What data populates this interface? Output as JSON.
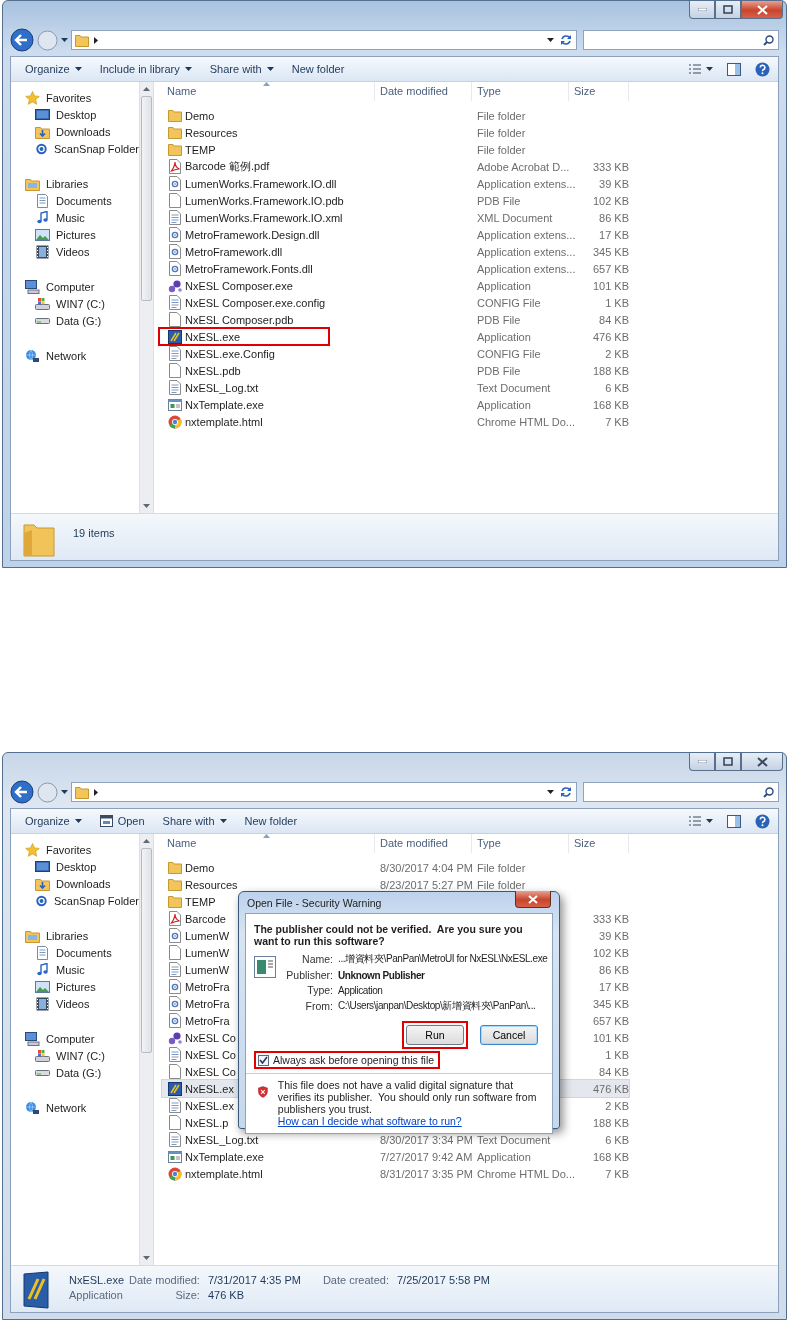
{
  "windows": [
    {
      "active": true,
      "toolbar": [
        {
          "label": "Organize",
          "kind": "menu"
        },
        {
          "label": "Include in library",
          "kind": "menu"
        },
        {
          "label": "Share with",
          "kind": "menu"
        },
        {
          "label": "New folder",
          "kind": "button"
        }
      ],
      "sidebar": {
        "items": [
          {
            "label": "Favorites",
            "kind": "favorites",
            "children": [
              {
                "label": "Desktop",
                "kind": "desktop"
              },
              {
                "label": "Downloads",
                "kind": "downloads"
              },
              {
                "label": "ScanSnap Folder",
                "kind": "scansnap"
              }
            ]
          },
          {
            "label": "Libraries",
            "kind": "libraries",
            "children": [
              {
                "label": "Documents",
                "kind": "documents"
              },
              {
                "label": "Music",
                "kind": "music"
              },
              {
                "label": "Pictures",
                "kind": "pictures"
              },
              {
                "label": "Videos",
                "kind": "videos"
              }
            ]
          },
          {
            "label": "Computer",
            "kind": "computer",
            "children": [
              {
                "label": "WIN7 (C:)",
                "kind": "system-drive"
              },
              {
                "label": "Data (G:)",
                "kind": "drive"
              }
            ]
          },
          {
            "label": "Network",
            "kind": "network"
          }
        ]
      },
      "columns": [
        "Name",
        "Date modified",
        "Type",
        "Size"
      ],
      "rows": [
        {
          "kind": "folder",
          "name": "Demo",
          "type": "File folder",
          "selected": false,
          "annotated": false
        },
        {
          "kind": "folder",
          "name": "Resources",
          "type": "File folder",
          "selected": false,
          "annotated": false
        },
        {
          "kind": "folder",
          "name": "TEMP",
          "type": "File folder",
          "selected": false,
          "annotated": false
        },
        {
          "kind": "pdf",
          "name": "Barcode 範例.pdf",
          "type": "Adobe Acrobat D...",
          "size": "333 KB",
          "selected": false,
          "annotated": false
        },
        {
          "kind": "dll",
          "name": "LumenWorks.Framework.IO.dll",
          "type": "Application extens...",
          "size": "39 KB",
          "selected": false,
          "annotated": false
        },
        {
          "kind": "blank",
          "name": "LumenWorks.Framework.IO.pdb",
          "type": "PDB File",
          "size": "102 KB",
          "selected": false,
          "annotated": false
        },
        {
          "kind": "xml",
          "name": "LumenWorks.Framework.IO.xml",
          "type": "XML Document",
          "size": "86 KB",
          "selected": false,
          "annotated": false
        },
        {
          "kind": "dll",
          "name": "MetroFramework.Design.dll",
          "type": "Application extens...",
          "size": "17 KB",
          "selected": false,
          "annotated": false
        },
        {
          "kind": "dll",
          "name": "MetroFramework.dll",
          "type": "Application extens...",
          "size": "345 KB",
          "selected": false,
          "annotated": false
        },
        {
          "kind": "dll",
          "name": "MetroFramework.Fonts.dll",
          "type": "Application extens...",
          "size": "657 KB",
          "selected": false,
          "annotated": false
        },
        {
          "kind": "composer",
          "name": "NxESL Composer.exe",
          "type": "Application",
          "size": "101 KB",
          "selected": false,
          "annotated": false
        },
        {
          "kind": "config",
          "name": "NxESL Composer.exe.config",
          "type": "CONFIG File",
          "size": "1 KB",
          "selected": false,
          "annotated": false
        },
        {
          "kind": "blank",
          "name": "NxESL Composer.pdb",
          "type": "PDB File",
          "size": "84 KB",
          "selected": false,
          "annotated": false
        },
        {
          "kind": "nxesl",
          "name": "NxESL.exe",
          "type": "Application",
          "size": "476 KB",
          "selected": false,
          "annotated": true
        },
        {
          "kind": "config",
          "name": "NxESL.exe.Config",
          "type": "CONFIG File",
          "size": "2 KB",
          "selected": false,
          "annotated": false
        },
        {
          "kind": "blank",
          "name": "NxESL.pdb",
          "type": "PDB File",
          "size": "188 KB",
          "selected": false,
          "annotated": false
        },
        {
          "kind": "text",
          "name": "NxESL_Log.txt",
          "type": "Text Document",
          "size": "6 KB",
          "selected": false,
          "annotated": false
        },
        {
          "kind": "app",
          "name": "NxTemplate.exe",
          "type": "Application",
          "size": "168 KB",
          "selected": false,
          "annotated": false
        },
        {
          "kind": "chrome",
          "name": "nxtemplate.html",
          "type": "Chrome HTML Do...",
          "size": "7 KB",
          "selected": false,
          "annotated": false
        }
      ],
      "status": {
        "kind": "summary",
        "text": "19 items"
      }
    },
    {
      "active": false,
      "toolbar": [
        {
          "label": "Organize",
          "kind": "menu"
        },
        {
          "label": "Open",
          "kind": "open"
        },
        {
          "label": "Share with",
          "kind": "menu"
        },
        {
          "label": "New folder",
          "kind": "button"
        }
      ],
      "sidebar": {
        "items": [
          {
            "label": "Favorites",
            "kind": "favorites",
            "children": [
              {
                "label": "Desktop",
                "kind": "desktop"
              },
              {
                "label": "Downloads",
                "kind": "downloads"
              },
              {
                "label": "ScanSnap Folder",
                "kind": "scansnap"
              }
            ]
          },
          {
            "label": "Libraries",
            "kind": "libraries",
            "children": [
              {
                "label": "Documents",
                "kind": "documents"
              },
              {
                "label": "Music",
                "kind": "music"
              },
              {
                "label": "Pictures",
                "kind": "pictures"
              },
              {
                "label": "Videos",
                "kind": "videos"
              }
            ]
          },
          {
            "label": "Computer",
            "kind": "computer",
            "children": [
              {
                "label": "WIN7 (C:)",
                "kind": "system-drive"
              },
              {
                "label": "Data (G:)",
                "kind": "drive"
              }
            ]
          },
          {
            "label": "Network",
            "kind": "network"
          }
        ]
      },
      "columns": [
        "Name",
        "Date modified",
        "Type",
        "Size"
      ],
      "rows": [
        {
          "kind": "folder",
          "name": "Demo",
          "date": "8/30/2017 4:04 PM",
          "type": "File folder",
          "selected": false,
          "annotated": false
        },
        {
          "kind": "folder",
          "name": "Resources",
          "date": "8/23/2017 5:27 PM",
          "type": "File folder",
          "selected": false,
          "annotated": false
        },
        {
          "kind": "folder",
          "name": "TEMP",
          "selected": false,
          "annotated": false
        },
        {
          "kind": "pdf",
          "name": "Barcode",
          "size": "333 KB",
          "selected": false,
          "annotated": false
        },
        {
          "kind": "dll",
          "name": "LumenW",
          "size": "39 KB",
          "selected": false,
          "annotated": false
        },
        {
          "kind": "blank",
          "name": "LumenW",
          "size": "102 KB",
          "selected": false,
          "annotated": false
        },
        {
          "kind": "xml",
          "name": "LumenW",
          "size": "86 KB",
          "selected": false,
          "annotated": false
        },
        {
          "kind": "dll",
          "name": "MetroFra",
          "size": "17 KB",
          "selected": false,
          "annotated": false
        },
        {
          "kind": "dll",
          "name": "MetroFra",
          "size": "345 KB",
          "selected": false,
          "annotated": false
        },
        {
          "kind": "dll",
          "name": "MetroFra",
          "size": "657 KB",
          "selected": false,
          "annotated": false
        },
        {
          "kind": "composer",
          "name": "NxESL Co",
          "size": "101 KB",
          "selected": false,
          "annotated": false
        },
        {
          "kind": "config",
          "name": "NxESL Co",
          "size": "1 KB",
          "selected": false,
          "annotated": false
        },
        {
          "kind": "blank",
          "name": "NxESL Co",
          "size": "84 KB",
          "selected": false,
          "annotated": false
        },
        {
          "kind": "nxesl",
          "name": "NxESL.ex",
          "size": "476 KB",
          "selected": true,
          "annotated": false
        },
        {
          "kind": "config",
          "name": "NxESL.ex",
          "size": "2 KB",
          "selected": false,
          "annotated": false
        },
        {
          "kind": "blank",
          "name": "NxESL.p",
          "size": "188 KB",
          "selected": false,
          "annotated": false
        },
        {
          "kind": "text",
          "name": "NxESL_Log.txt",
          "date": "8/30/2017 3:34 PM",
          "type": "Text Document",
          "size": "6 KB",
          "selected": false,
          "annotated": false
        },
        {
          "kind": "app",
          "name": "NxTemplate.exe",
          "date": "7/27/2017 9:42 AM",
          "type": "Application",
          "size": "168 KB",
          "selected": false,
          "annotated": false
        },
        {
          "kind": "chrome",
          "name": "nxtemplate.html",
          "date": "8/31/2017 3:35 PM",
          "type": "Chrome HTML Do...",
          "size": "7 KB",
          "selected": false,
          "annotated": false
        }
      ],
      "status": {
        "kind": "details",
        "name": "NxESL.exe",
        "type": "Application",
        "fields": [
          {
            "label": "Date modified:",
            "value": "7/31/2017 4:35 PM"
          },
          {
            "label": "Date created:",
            "value": "7/25/2017 5:58 PM"
          },
          {
            "label": "Size:",
            "value": "476 KB"
          }
        ]
      },
      "dialog": {
        "title": "Open File - Security Warning",
        "heading": "The publisher could not be verified.  Are you sure you want to run this software?",
        "details": [
          {
            "label": "Name:",
            "value": "...增資料夾\\PanPan\\MetroUI for NxESL\\NxESL.exe",
            "emphasis": false
          },
          {
            "label": "Publisher:",
            "value": "Unknown Publisher",
            "emphasis": true
          },
          {
            "label": "Type:",
            "value": "Application",
            "emphasis": false
          },
          {
            "label": "From:",
            "value": "C:\\Users\\janpan\\Desktop\\新增資料夾\\PanPan\\...",
            "emphasis": false
          }
        ],
        "buttons": [
          {
            "label": "Run",
            "annotated": true
          },
          {
            "label": "Cancel",
            "annotated": false
          }
        ],
        "checkbox": {
          "label": "Always ask before opening this file",
          "checked": true,
          "annotated": true
        },
        "warning": "This file does not have a valid digital signature that verifies its publisher.  You should only run software from publishers you trust.",
        "link": "How can I decide what software to run?"
      }
    }
  ]
}
